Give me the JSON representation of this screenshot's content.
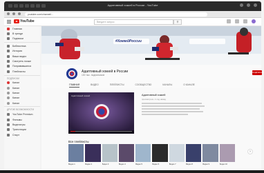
{
  "browser": {
    "window_title": "Адаптивный хоккей в России - YouTube",
    "url": "youtube.com/channel/..."
  },
  "header": {
    "logo_text": "YouTube",
    "search_placeholder": "Введите запрос"
  },
  "sidebar": {
    "items": [
      {
        "label": "Главная",
        "icon": "home-icon"
      },
      {
        "label": "В тренде",
        "icon": "fire-icon"
      },
      {
        "label": "Подписки",
        "icon": "subscriptions-icon"
      },
      {
        "label": "Библиотека",
        "icon": "library-icon"
      },
      {
        "label": "История",
        "icon": "history-icon"
      },
      {
        "label": "Ваши видео",
        "icon": "video-icon"
      },
      {
        "label": "Смотреть позже",
        "icon": "clock-icon"
      },
      {
        "label": "Понравившиеся",
        "icon": "like-icon"
      },
      {
        "label": "Плейлисты",
        "icon": "playlist-icon"
      }
    ],
    "subscriptions_heading": "ПОДПИСКИ",
    "subscriptions": [
      "Канал",
      "Канал",
      "Канал",
      "Канал",
      "Канал"
    ],
    "more_heading": "ДРУГИЕ ВОЗМОЖНОСТИ",
    "more": [
      "YouTube Premium",
      "Фильмы",
      "Видеоигры",
      "Трансляции",
      "Спорт"
    ]
  },
  "channel": {
    "banner_text": "#ХоккейРоссии",
    "name": "Адаптивный хоккей в России",
    "subscribers": "100 тыс. подписчиков",
    "subscribe_label": "ПОДПИСАТЬСЯ",
    "tabs": [
      "ГЛАВНАЯ",
      "ВИДЕО",
      "ПЛЕЙЛИСТЫ",
      "СООБЩЕСТВО",
      "КАНАЛЫ",
      "О КАНАЛЕ"
    ],
    "active_tab_index": 0
  },
  "featured": {
    "title": "Адаптивный хоккей",
    "meta": "просмотров • 1 год назад",
    "player_caption": "Адаптивный хоккей",
    "progress": 0.08
  },
  "uploads": {
    "heading": "Все плейлисты",
    "thumbs": [
      {
        "caption": "Видео 1",
        "color": "#6b7fa0"
      },
      {
        "caption": "Видео 2",
        "color": "#3a2f5a"
      },
      {
        "caption": "Видео 3",
        "color": "#b7c3c9"
      },
      {
        "caption": "Видео 4",
        "color": "#5b4a6a"
      },
      {
        "caption": "Видео 5",
        "color": "#9fb6cc"
      },
      {
        "caption": "Видео 6",
        "color": "#2b2b2b"
      },
      {
        "caption": "Видео 7",
        "color": "#cfd8e0"
      },
      {
        "caption": "Видео 8",
        "color": "#39406b"
      },
      {
        "caption": "Видео 9",
        "color": "#7f8aa0"
      },
      {
        "caption": "Видео 10",
        "color": "#ab9bb0"
      },
      {
        "caption": "Видео 11",
        "color": "#5d6f84"
      },
      {
        "caption": "Видео 12",
        "color": "#c7cfd6"
      }
    ]
  },
  "colors": {
    "accent": "#cc0000",
    "banner_bg": "#dfe6ee",
    "player_bg": "#3c2b4f"
  }
}
